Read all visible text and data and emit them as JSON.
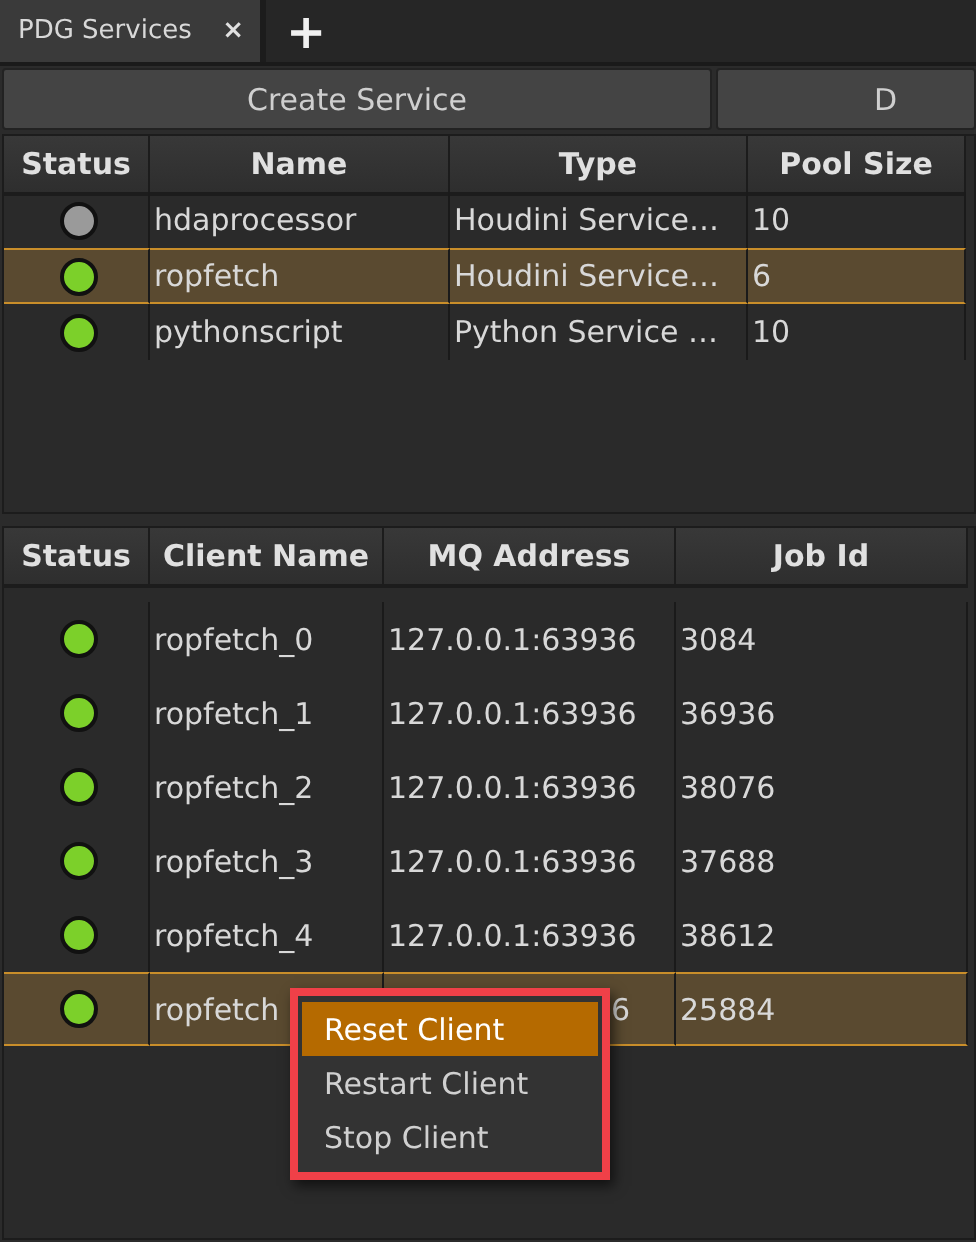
{
  "tabs": [
    {
      "label": "PDG Services",
      "selected": true,
      "close": "×"
    }
  ],
  "add_tab": "+",
  "buttons": [
    "Create Service",
    "D"
  ],
  "services_table": {
    "columns": [
      "Status",
      "Name",
      "Type",
      "Pool Size"
    ],
    "rows": [
      {
        "color": "#9a9a9a",
        "name": "hdaprocessor",
        "type": "Houdini Service…",
        "pool_size": "10",
        "selected": false
      },
      {
        "color": "#7cd02a",
        "name": "ropfetch",
        "type": "Houdini Service…",
        "pool_size": "6",
        "selected": true
      },
      {
        "color": "#7cd02a",
        "name": "pythonscript",
        "type": "Python Service …",
        "pool_size": "10",
        "selected": false
      }
    ]
  },
  "clients_table": {
    "columns": [
      "Status",
      "Client Name",
      "MQ Address",
      "Job Id"
    ],
    "rows": [
      {
        "color": "#7cd02a",
        "client_name": "ropfetch_0",
        "mq_address": "127.0.0.1:63936",
        "job_id": "3084",
        "selected": false
      },
      {
        "color": "#7cd02a",
        "client_name": "ropfetch_1",
        "mq_address": "127.0.0.1:63936",
        "job_id": "36936",
        "selected": false
      },
      {
        "color": "#7cd02a",
        "client_name": "ropfetch_2",
        "mq_address": "127.0.0.1:63936",
        "job_id": "38076",
        "selected": false
      },
      {
        "color": "#7cd02a",
        "client_name": "ropfetch_3",
        "mq_address": "127.0.0.1:63936",
        "job_id": "37688",
        "selected": false
      },
      {
        "color": "#7cd02a",
        "client_name": "ropfetch_4",
        "mq_address": "127.0.0.1:63936",
        "job_id": "38612",
        "selected": false
      },
      {
        "color": "#7cd02a",
        "client_name": "ropfetch",
        "mq_address": "6",
        "job_id": "25884",
        "selected": true,
        "covered": true
      }
    ]
  },
  "context_menu": {
    "items": [
      {
        "label": "Reset Client",
        "selected": true
      },
      {
        "label": "Restart Client",
        "selected": false
      },
      {
        "label": "Stop Client",
        "selected": false
      }
    ]
  }
}
